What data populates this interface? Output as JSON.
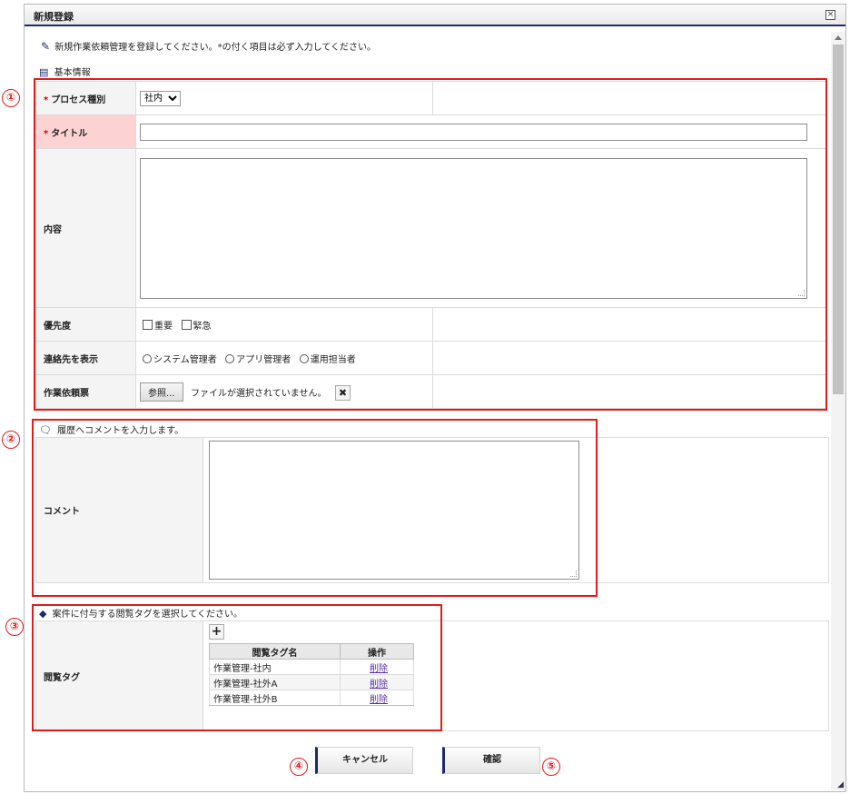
{
  "window": {
    "title": "新規登録",
    "close_icon": "close-icon"
  },
  "intro_text": "新規作業依頼管理を登録してください。*の付く項目は必ず入力してください。",
  "basic": {
    "heading": "基本情報",
    "process_label": "プロセス種別",
    "process_value": "社内",
    "title_label": "タイトル",
    "title_value": "",
    "content_label": "内容",
    "content_value": "",
    "priority_label": "優先度",
    "priority_options": [
      "重要",
      "緊急"
    ],
    "contact_label": "連絡先を表示",
    "contact_options": [
      "システム管理者",
      "アプリ管理者",
      "運用担当者"
    ],
    "attach_label": "作業依頼票",
    "browse_label": "参照...",
    "no_file_text": "ファイルが選択されていません。",
    "required_mark": "*"
  },
  "history": {
    "heading": "履歴へコメントを入力します。",
    "comment_label": "コメント",
    "comment_value": ""
  },
  "tags": {
    "heading": "案件に付与する閲覧タグを選択してください。",
    "label": "閲覧タグ",
    "add_symbol": "+",
    "columns": [
      "閲覧タグ名",
      "操作"
    ],
    "rows": [
      {
        "name": "作業管理-社内",
        "action": "削除"
      },
      {
        "name": "作業管理-社外A",
        "action": "削除"
      },
      {
        "name": "作業管理-社外B",
        "action": "削除"
      }
    ]
  },
  "buttons": {
    "cancel": "キャンセル",
    "confirm": "確認"
  },
  "markers": [
    "①",
    "②",
    "③",
    "④",
    "⑤"
  ],
  "colors": {
    "accent": "#1f2a6b",
    "required_bg": "#fcd2d2",
    "annotation": "#e31b1b"
  }
}
